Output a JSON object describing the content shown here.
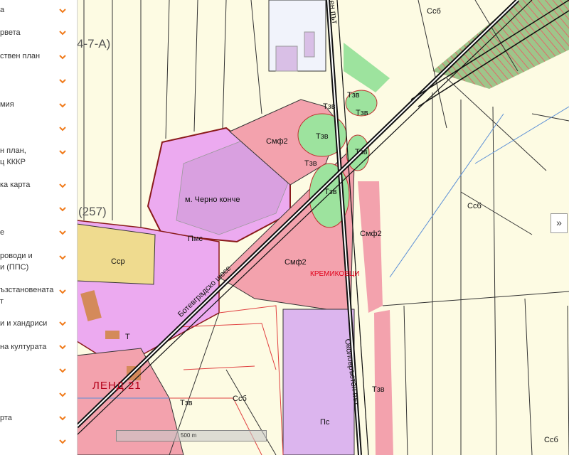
{
  "sidebar": {
    "items": [
      {
        "label": "а"
      },
      {
        "label": "рвета"
      },
      {
        "label": "ствен план"
      },
      {
        "label": ""
      },
      {
        "label": "мия"
      },
      {
        "label": ""
      },
      {
        "label": "н план,\nц КККР"
      },
      {
        "label": "ка карта"
      },
      {
        "label": ""
      },
      {
        "label": "е"
      },
      {
        "label": "роводи и\nи (ППС)"
      },
      {
        "label": "ъзстановената\nт"
      },
      {
        "label": "и и хандриси"
      },
      {
        "label": "на културата"
      },
      {
        "label": ""
      },
      {
        "label": ""
      },
      {
        "label": "рта"
      },
      {
        "label": ""
      }
    ]
  },
  "map": {
    "labels": {
      "a7": "4-7-А)",
      "n257": "(257)",
      "ssb_top": "Ссб",
      "smf2_a": "Смф2",
      "smf2_b": "Смф2",
      "smf2_c": "Смф2",
      "tzv1": "Тзв",
      "tzv2": "Тзв",
      "tzv3": "Тзв",
      "tzv4": "Тзв",
      "tzv5": "Тзв",
      "tzv6": "Тзв",
      "tzv7": "Тзв",
      "tzv8": "Тзв",
      "tzv9": "Тзв",
      "cherno_konche": "м. Черно конче",
      "pms": "Пмс",
      "ssr": "Сср",
      "ssb_mid": "Ссб",
      "ssb_bottom": "Ссб",
      "ssb_br": "Ссб",
      "ps": "Пс",
      "kremikovtsi": "КРЕМИКОВЦИ",
      "botevgradsko": "Ботевградско шосе",
      "okolovrasten": "Околовръстен път",
      "okolo_top": "ен път",
      "legend": "ЛЕНД 21",
      "t_small": "Т"
    },
    "scale_label": "500 m",
    "expand_icon": "»"
  }
}
